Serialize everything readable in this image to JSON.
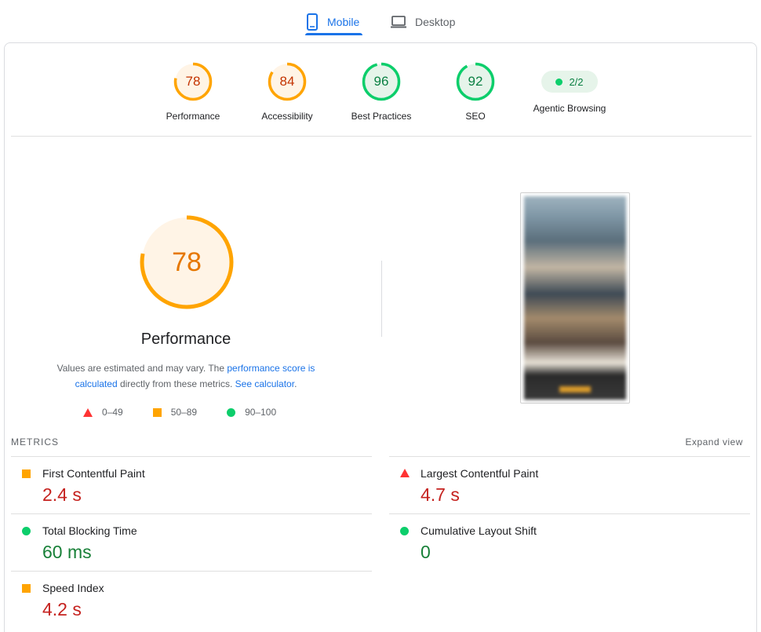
{
  "tabs": [
    {
      "label": "Mobile",
      "icon": "smartphone-icon",
      "active": true
    },
    {
      "label": "Desktop",
      "icon": "laptop-icon",
      "active": false
    }
  ],
  "gauges": [
    {
      "score": "78",
      "label": "Performance",
      "color": "#ffa400",
      "fraction": 0.78
    },
    {
      "score": "84",
      "label": "Accessibility",
      "color": "#ffa400",
      "fraction": 0.84
    },
    {
      "score": "96",
      "label": "Best Practices",
      "color": "#0cce6b",
      "fraction": 0.96
    },
    {
      "score": "92",
      "label": "SEO",
      "color": "#0cce6b",
      "fraction": 0.92
    }
  ],
  "agentic": {
    "label": "Agentic Browsing",
    "value": "2/2"
  },
  "performance": {
    "score": "78",
    "fraction": 0.78,
    "title": "Performance",
    "desc_prefix": "Values are estimated and may vary. The ",
    "desc_link1": "performance score is calculated",
    "desc_middle": " directly from these metrics. ",
    "desc_link2": "See calculator",
    "desc_suffix": "."
  },
  "legend": [
    {
      "shape": "triangle",
      "label": "0–49",
      "color": "#ff3333"
    },
    {
      "shape": "square",
      "label": "50–89",
      "color": "#ffa400"
    },
    {
      "shape": "circle",
      "label": "90–100",
      "color": "#0cce6b"
    }
  ],
  "metrics": {
    "header": "METRICS",
    "expand_label": "Expand view",
    "items": [
      {
        "name": "First Contentful Paint",
        "value": "2.4 s",
        "rating": "average"
      },
      {
        "name": "Largest Contentful Paint",
        "value": "4.7 s",
        "rating": "fail"
      },
      {
        "name": "Total Blocking Time",
        "value": "60 ms",
        "rating": "pass"
      },
      {
        "name": "Cumulative Layout Shift",
        "value": "0",
        "rating": "pass"
      },
      {
        "name": "Speed Index",
        "value": "4.2 s",
        "rating": "average"
      }
    ]
  },
  "colors": {
    "orange": "#ffa400",
    "green": "#0cce6b",
    "red": "#ff3333",
    "link": "#1a73e8"
  }
}
